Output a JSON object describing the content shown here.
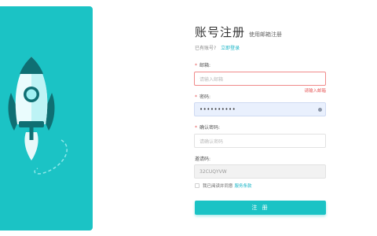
{
  "header": {
    "title": "账号注册",
    "subtitle": "使用邮箱注册"
  },
  "login_prompt": {
    "text": "已有账号?",
    "link": "立即登录"
  },
  "form": {
    "email": {
      "label": "邮箱:",
      "placeholder": "请输入邮箱",
      "error": "请输入邮箱",
      "required": true
    },
    "password": {
      "label": "密码:",
      "value": "••••••••••",
      "required": true
    },
    "confirm": {
      "label": "确认密码:",
      "placeholder": "请确认密码",
      "required": true
    },
    "invite": {
      "label": "邀请码:",
      "value": "32CUQYVW"
    },
    "agree": {
      "text": "我已阅读并同意",
      "link": "服务条款"
    },
    "submit_label": "注 册"
  },
  "colors": {
    "accent": "#1bc3c5",
    "error": "#e65a5a",
    "link": "#1bb5c7"
  },
  "icons": [
    "rocket-illustration",
    "eye-icon",
    "checkbox"
  ]
}
